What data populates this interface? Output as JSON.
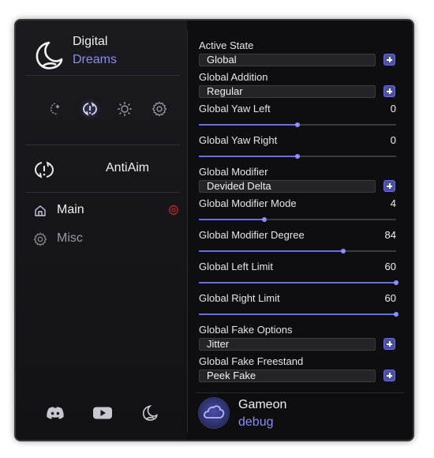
{
  "brand": {
    "line1": "Digital",
    "line2": "Dreams",
    "icon": "moon-icon"
  },
  "tabs": [
    {
      "icon": "moon-sparkle-icon",
      "active": false
    },
    {
      "icon": "antiaim-arrows-icon",
      "active": true
    },
    {
      "icon": "sun-icon",
      "active": false
    },
    {
      "icon": "gear-icon",
      "active": false
    }
  ],
  "section": {
    "label": "AntiAim",
    "icon": "antiaim-arrows-icon"
  },
  "nav": [
    {
      "label": "Main",
      "icon": "home-icon",
      "active": true
    },
    {
      "label": "Misc",
      "icon": "gear-icon",
      "active": false
    }
  ],
  "footer": [
    "discord-icon",
    "youtube-icon",
    "moon-icon"
  ],
  "controls": {
    "active_state": {
      "label": "Active State",
      "value": "Global"
    },
    "global_addition": {
      "label": "Global Addition",
      "value": "Regular"
    },
    "global_yaw_left": {
      "label": "Global Yaw Left",
      "value": "0",
      "fraction": 0.5
    },
    "global_yaw_right": {
      "label": "Global Yaw Right",
      "value": "0",
      "fraction": 0.5
    },
    "global_modifier": {
      "label": "Global Modifier",
      "value": "Devided Delta"
    },
    "global_modifier_mode": {
      "label": "Global Modifier Mode",
      "value": "4",
      "fraction": 0.33
    },
    "global_modifier_degree": {
      "label": "Global Modifier Degree",
      "value": "84",
      "fraction": 0.73
    },
    "global_left_limit": {
      "label": "Global Left Limit",
      "value": "60",
      "fraction": 1.0
    },
    "global_right_limit": {
      "label": "Global Right Limit",
      "value": "60",
      "fraction": 1.0
    },
    "global_fake_options": {
      "label": "Global Fake Options",
      "value": "Jitter"
    },
    "global_fake_freestand": {
      "label": "Global Fake Freestand",
      "value": "Peek Fake"
    }
  },
  "user": {
    "name": "Gameon",
    "role": "debug",
    "avatar_icon": "cloud-icon"
  },
  "colors": {
    "accent": "#8a8ef0",
    "slider": "#6a6ee8",
    "background": "#0e0e11",
    "alert": "#c0282a"
  }
}
